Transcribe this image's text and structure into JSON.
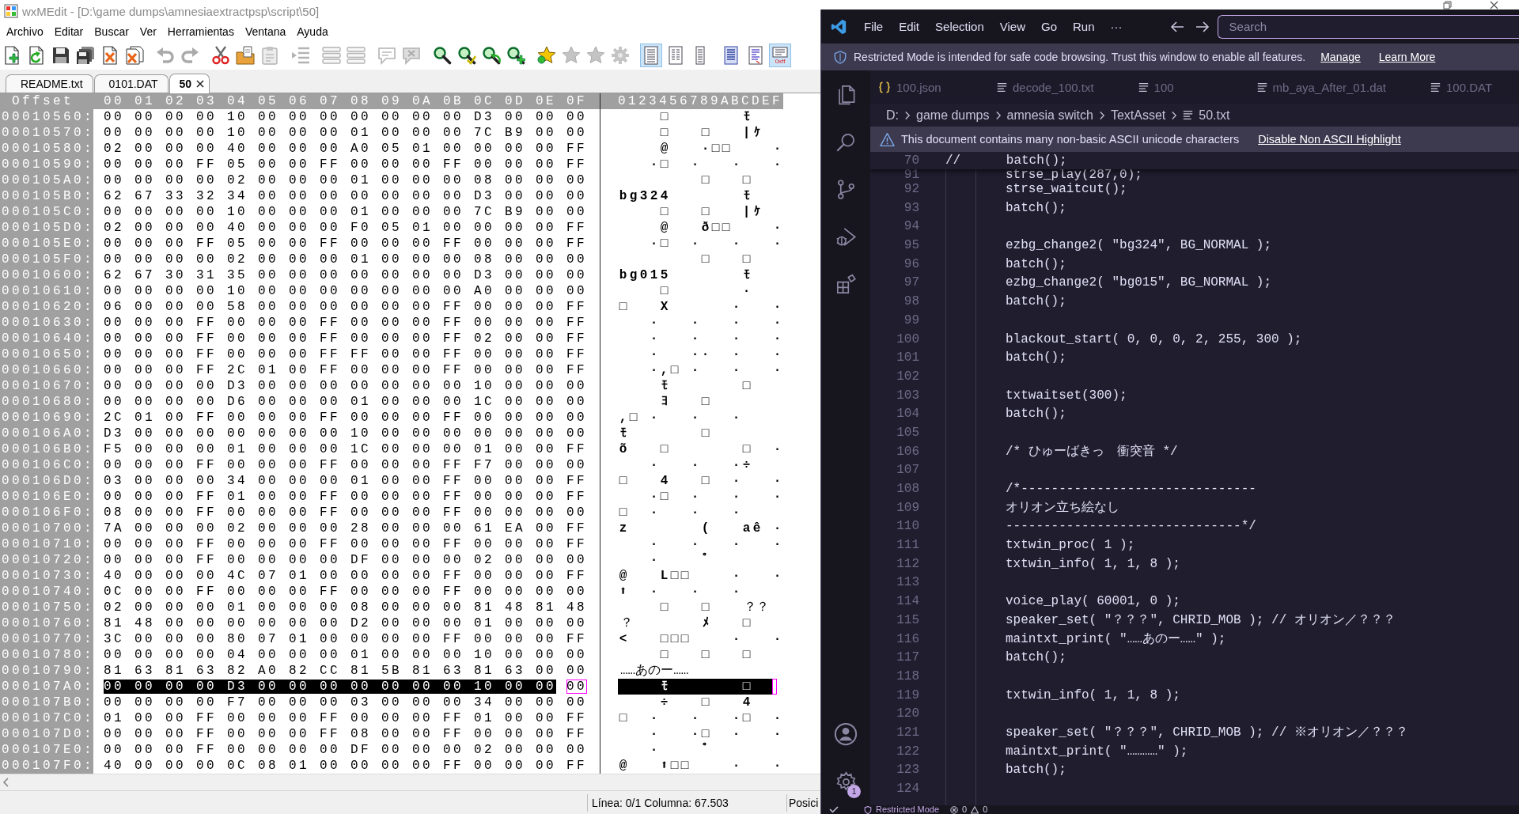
{
  "editor_window": {
    "title": "wxMEdit - [D:\\game dumps\\amnesiaextractpsp\\script\\50]",
    "menu": [
      "Archivo",
      "Editar",
      "Buscar",
      "Ver",
      "Herramientas",
      "Ventana",
      "Ayuda"
    ],
    "toolbar": [
      [
        {
          "kind": "new",
          "disabled": false,
          "pressed": false
        },
        {
          "kind": "reload",
          "disabled": false,
          "pressed": false
        },
        {
          "kind": "save",
          "disabled": false,
          "pressed": false
        },
        {
          "kind": "save-all",
          "disabled": false,
          "pressed": false
        },
        {
          "kind": "close",
          "disabled": false,
          "pressed": false
        },
        {
          "kind": "close-all",
          "disabled": false,
          "pressed": false
        }
      ],
      [
        {
          "kind": "undo",
          "disabled": true,
          "pressed": false
        },
        {
          "kind": "redo",
          "disabled": true,
          "pressed": false
        }
      ],
      [
        {
          "kind": "cut",
          "disabled": false,
          "pressed": false
        },
        {
          "kind": "copy",
          "disabled": false,
          "pressed": false
        },
        {
          "kind": "paste",
          "disabled": true,
          "pressed": false
        }
      ],
      [
        {
          "kind": "indent",
          "disabled": true,
          "pressed": false
        }
      ],
      [
        {
          "kind": "lines",
          "disabled": true,
          "pressed": false
        },
        {
          "kind": "lines",
          "disabled": true,
          "pressed": false
        }
      ],
      [
        {
          "kind": "comment",
          "disabled": true,
          "pressed": false
        },
        {
          "kind": "uncomment",
          "disabled": true,
          "pressed": false
        }
      ],
      [
        {
          "kind": "find",
          "disabled": false,
          "pressed": false
        },
        {
          "kind": "find-next",
          "disabled": false,
          "pressed": false
        },
        {
          "kind": "find-previous",
          "disabled": false,
          "pressed": false
        },
        {
          "kind": "replace",
          "disabled": false,
          "pressed": false
        }
      ],
      [
        {
          "kind": "bookmark",
          "disabled": false,
          "pressed": false
        },
        {
          "kind": "star",
          "disabled": true,
          "pressed": false
        },
        {
          "kind": "star",
          "disabled": true,
          "pressed": false
        },
        {
          "kind": "cog",
          "disabled": true,
          "pressed": false
        }
      ],
      [
        {
          "kind": "text-view",
          "disabled": false,
          "pressed": true
        },
        {
          "kind": "column-view",
          "disabled": false,
          "pressed": false
        },
        {
          "kind": "narrow-view",
          "disabled": false,
          "pressed": false
        }
      ],
      [
        {
          "kind": "list-view",
          "disabled": false,
          "pressed": false
        },
        {
          "kind": "lines-view",
          "disabled": false,
          "pressed": false
        },
        {
          "kind": "hex-view",
          "disabled": false,
          "pressed": true,
          "label": "0xff"
        }
      ]
    ],
    "tabs": [
      {
        "label": "README.txt",
        "selected": false
      },
      {
        "label": "0101.DAT",
        "selected": false
      },
      {
        "label": "50",
        "selected": true
      }
    ],
    "hex_view": {
      "offset_heading": "Offset",
      "byte_headings": "00 01 02 03 04 05 06 07 08 09 0A 0B 0C 0D 0E 0F",
      "text_heading": "0123456789ABCDEF",
      "rows": [
        {
          "offset": "00010560:",
          "hex": "00 00 00 00 10 00 00 00 00 00 00 00 D3 00 00 00",
          "text": "    □       ﾓ   ",
          "selected": false
        },
        {
          "offset": "00010570:",
          "hex": "00 00 00 00 10 00 00 00 01 00 00 00 7C B9 00 00",
          "text": "    □   □   |ｹ  ",
          "selected": false
        },
        {
          "offset": "00010580:",
          "hex": "02 00 00 00 40 00 00 00 A0 05 01 00 00 00 00 FF",
          "text": "    @   ·□□    ·",
          "selected": false
        },
        {
          "offset": "00010590:",
          "hex": "00 00 00 FF 05 00 00 FF 00 00 00 FF 00 00 00 FF",
          "text": "   ·□  ·   ·   ·",
          "selected": false
        },
        {
          "offset": "000105A0:",
          "hex": "00 00 00 00 02 00 00 00 01 00 00 00 08 00 00 00",
          "text": "        □   □   ",
          "selected": false
        },
        {
          "offset": "000105B0:",
          "hex": "62 67 33 32 34 00 00 00 00 00 00 00 D3 00 00 00",
          "text": "bg324       ﾓ   ",
          "selected": false
        },
        {
          "offset": "000105C0:",
          "hex": "00 00 00 00 10 00 00 00 01 00 00 00 7C B9 00 00",
          "text": "    □   □   |ｹ  ",
          "selected": false
        },
        {
          "offset": "000105D0:",
          "hex": "02 00 00 00 40 00 00 00 F0 05 01 00 00 00 00 FF",
          "text": "    @   ð□□    ·",
          "selected": false
        },
        {
          "offset": "000105E0:",
          "hex": "00 00 00 FF 05 00 00 FF 00 00 00 FF 00 00 00 FF",
          "text": "   ·□  ·   ·   ·",
          "selected": false
        },
        {
          "offset": "000105F0:",
          "hex": "00 00 00 00 02 00 00 00 01 00 00 00 08 00 00 00",
          "text": "        □   □   ",
          "selected": false
        },
        {
          "offset": "00010600:",
          "hex": "62 67 30 31 35 00 00 00 00 00 00 00 D3 00 00 00",
          "text": "bg015       ﾓ   ",
          "selected": false
        },
        {
          "offset": "00010610:",
          "hex": "00 00 00 00 10 00 00 00 00 00 00 00 A0 00 00 00",
          "text": "    □       ·   ",
          "selected": false
        },
        {
          "offset": "00010620:",
          "hex": "06 00 00 00 58 00 00 00 00 00 00 FF 00 00 00 FF",
          "text": "□   X      ·   ·",
          "selected": false
        },
        {
          "offset": "00010630:",
          "hex": "00 00 00 FF 00 00 00 FF 00 00 00 FF 00 00 00 FF",
          "text": "   ·   ·   ·   ·",
          "selected": false
        },
        {
          "offset": "00010640:",
          "hex": "00 00 00 FF 00 00 00 FF 00 00 00 FF 02 00 00 FF",
          "text": "   ·   ·   ·   ·",
          "selected": false
        },
        {
          "offset": "00010650:",
          "hex": "00 00 00 FF 00 00 00 FF FF 00 00 FF 00 00 00 FF",
          "text": "   ·   ··  ·   ·",
          "selected": false
        },
        {
          "offset": "00010660:",
          "hex": "00 00 00 FF 2C 01 00 FF 00 00 00 FF 00 00 00 FF",
          "text": "   ·,□ ·   ·   ·",
          "selected": false
        },
        {
          "offset": "00010670:",
          "hex": "00 00 00 00 D3 00 00 00 00 00 00 00 10 00 00 00",
          "text": "    ﾓ       □   ",
          "selected": false
        },
        {
          "offset": "00010680:",
          "hex": "00 00 00 00 D6 00 00 00 01 00 00 00 1C 00 00 00",
          "text": "    ﾖ   □       ",
          "selected": false
        },
        {
          "offset": "00010690:",
          "hex": "2C 01 00 FF 00 00 00 FF 00 00 00 FF 00 00 00 00",
          "text": ",□ ·   ·   ·    ",
          "selected": false
        },
        {
          "offset": "000106A0:",
          "hex": "D3 00 00 00 00 00 00 00 10 00 00 00 00 00 00 00",
          "text": "ﾓ       □       ",
          "selected": false
        },
        {
          "offset": "000106B0:",
          "hex": "F5 00 00 00 01 00 00 00 1C 00 00 00 01 00 00 FF",
          "text": "õ   □       □  ·",
          "selected": false
        },
        {
          "offset": "000106C0:",
          "hex": "00 00 00 FF 00 00 00 FF 00 00 00 FF F7 00 00 00",
          "text": "   ·   ·   ·÷   ",
          "selected": false
        },
        {
          "offset": "000106D0:",
          "hex": "03 00 00 00 34 00 00 00 01 00 00 FF 00 00 00 FF",
          "text": "□   4   □  ·   ·",
          "selected": false
        },
        {
          "offset": "000106E0:",
          "hex": "00 00 00 FF 01 00 00 FF 00 00 00 FF 00 00 00 FF",
          "text": "   ·□  ·   ·   ·",
          "selected": false
        },
        {
          "offset": "000106F0:",
          "hex": "08 00 00 FF 00 00 00 FF 00 00 00 FF 00 00 00 00",
          "text": "□  ·   ·   ·    ",
          "selected": false
        },
        {
          "offset": "00010700:",
          "hex": "7A 00 00 00 02 00 00 00 28 00 00 00 61 EA 00 FF",
          "text": "z       (   aê ·",
          "selected": false
        },
        {
          "offset": "00010710:",
          "hex": "00 00 00 FF 00 00 00 FF 00 00 00 FF 00 00 00 FF",
          "text": "   ·   ·   ·   ·",
          "selected": false
        },
        {
          "offset": "00010720:",
          "hex": "00 00 00 FF 00 00 00 00 DF 00 00 00 02 00 00 00",
          "text": "   ·    ﾟ       ",
          "selected": false
        },
        {
          "offset": "00010730:",
          "hex": "40 00 00 00 4C 07 01 00 00 00 00 FF 00 00 00 FF",
          "text": "@   L□□    ·   ·",
          "selected": false
        },
        {
          "offset": "00010740:",
          "hex": "0C 00 00 FF 00 00 00 FF 00 00 00 FF 00 00 00 00",
          "text": "⬆  ·   ·   ·    ",
          "selected": false
        },
        {
          "offset": "00010750:",
          "hex": "02 00 00 00 01 00 00 00 08 00 00 00 81 48 81 48",
          "text": "    □   □   ？？",
          "selected": false
        },
        {
          "offset": "00010760:",
          "hex": "81 48 00 00 00 00 00 00 D2 00 00 00 01 00 00 00",
          "text": "？      ﾒ   □   ",
          "selected": false
        },
        {
          "offset": "00010770:",
          "hex": "3C 00 00 00 80 07 01 00 00 00 00 FF 00 00 00 FF",
          "text": "<   □□□    ·   ·",
          "selected": false
        },
        {
          "offset": "00010780:",
          "hex": "00 00 00 00 04 00 00 00 01 00 00 00 10 00 00 00",
          "text": "    □   □   □   ",
          "selected": false
        },
        {
          "offset": "00010790:",
          "hex": "81 63 81 63 82 A0 82 CC 81 5B 81 63 81 63 00 00",
          "text": "……あのー……  ",
          "selected": false
        },
        {
          "offset": "000107A0:",
          "hex": "00 00 00 00 D3 00 00 00 00 00 00 00 10 00 00 00",
          "text": "    ﾓ       □   ",
          "selected": true
        },
        {
          "offset": "000107B0:",
          "hex": "00 00 00 00 F7 00 00 00 03 00 00 00 34 00 00 00",
          "text": "    ÷   □   4   ",
          "selected": false
        },
        {
          "offset": "000107C0:",
          "hex": "01 00 00 FF 00 00 00 FF 00 00 00 FF 01 00 00 FF",
          "text": "□  ·   ·   ·□  ·",
          "selected": false
        },
        {
          "offset": "000107D0:",
          "hex": "00 00 00 FF 00 00 00 FF 08 00 00 FF 00 00 00 FF",
          "text": "   ·   ·□  ·   ·",
          "selected": false
        },
        {
          "offset": "000107E0:",
          "hex": "00 00 00 FF 00 00 00 00 DF 00 00 00 02 00 00 00",
          "text": "   ·    ﾟ       ",
          "selected": false
        },
        {
          "offset": "000107F0:",
          "hex": "40 00 00 00 0C 08 01 00 00 00 00 FF 00 00 00 FF",
          "text": "@   ⬆□□    ·   ·",
          "selected": false
        }
      ]
    },
    "status_bar": [
      "Línea: 0/1 Columna: 67.503",
      "Posici"
    ]
  },
  "code_window": {
    "menu": [
      "File",
      "Edit",
      "Selection",
      "View",
      "Go",
      "Run",
      "···"
    ],
    "search": {
      "placeholder": "Search"
    },
    "restricted_banner": {
      "message": "Restricted Mode is intended for safe code browsing. Trust this window to enable all features.",
      "links": [
        "Manage",
        "Learn More"
      ]
    },
    "activity_bar": {
      "settings_badge": "1"
    },
    "tabs": [
      {
        "label": "100.json",
        "kind": "json",
        "selected": false
      },
      {
        "label": "decode_100.txt",
        "kind": "text",
        "selected": false
      },
      {
        "label": "100",
        "kind": "text",
        "selected": false
      },
      {
        "label": "mb_aya_After_01.dat",
        "kind": "text",
        "selected": false
      },
      {
        "label": "100.DAT",
        "kind": "text",
        "selected": false
      }
    ],
    "breadcrumbs": [
      {
        "label": "D:",
        "kind": "folder"
      },
      {
        "label": "game dumps",
        "kind": "folder"
      },
      {
        "label": "amnesia switch",
        "kind": "folder"
      },
      {
        "label": "TextAsset",
        "kind": "folder"
      },
      {
        "label": "50.txt",
        "kind": "file"
      }
    ],
    "notice": {
      "message": "This document contains many non-basic ASCII unicode characters",
      "link": "Disable Non ASCII Highlight"
    },
    "sticky_line": {
      "number": "70",
      "text": "//      batch();"
    },
    "lines": [
      {
        "number": "91",
        "text": "strse_play(287,0);"
      },
      {
        "number": "92",
        "text": "strse_waitcut();"
      },
      {
        "number": "93",
        "text": "batch();"
      },
      {
        "number": "94"
      },
      {
        "number": "95",
        "text": "ezbg_change2( \"bg324\", BG_NORMAL );"
      },
      {
        "number": "96",
        "text": "batch();"
      },
      {
        "number": "97",
        "text": "ezbg_change2( \"bg015\", BG_NORMAL );"
      },
      {
        "number": "98",
        "text": "batch();"
      },
      {
        "number": "99"
      },
      {
        "number": "100",
        "text": "blackout_start( 0, 0, 0, 2, 255, 300 );"
      },
      {
        "number": "101",
        "text": "batch();"
      },
      {
        "number": "102"
      },
      {
        "number": "103",
        "text": "txtwaitset(300);"
      },
      {
        "number": "104",
        "text": "batch();"
      },
      {
        "number": "105"
      },
      {
        "number": "106",
        "text": "/* ひゅーばきっ　衝突音 */"
      },
      {
        "number": "107"
      },
      {
        "number": "108",
        "text": "/*-------------------------------"
      },
      {
        "number": "109",
        "text": "オリオン立ち絵なし"
      },
      {
        "number": "110",
        "text": "-------------------------------*/"
      },
      {
        "number": "111",
        "text": "txtwin_proc( 1 );"
      },
      {
        "number": "112",
        "text": "txtwin_info( 1, 1, 8 );"
      },
      {
        "number": "113"
      },
      {
        "number": "114",
        "text": "voice_play( 60001, 0 );"
      },
      {
        "number": "115",
        "text": "speaker_set( \"？？？\", CHRID_MOB ); // オリオン／？？？"
      },
      {
        "number": "116",
        "text": "maintxt_print( \"……あのー……\" );"
      },
      {
        "number": "117",
        "text": "batch();"
      },
      {
        "number": "118"
      },
      {
        "number": "119",
        "text": "txtwin_info( 1, 1, 8 );"
      },
      {
        "number": "120"
      },
      {
        "number": "121",
        "text": "speaker_set( \"？？？\", CHRID_MOB ); // ※オリオン／？？？"
      },
      {
        "number": "122",
        "text": "maintxt_print( \"…………\" );"
      },
      {
        "number": "123",
        "text": "batch();"
      },
      {
        "number": "124"
      }
    ],
    "status_bar": {
      "mode": "Restricted Mode",
      "errors": "0",
      "warnings": "0"
    }
  }
}
